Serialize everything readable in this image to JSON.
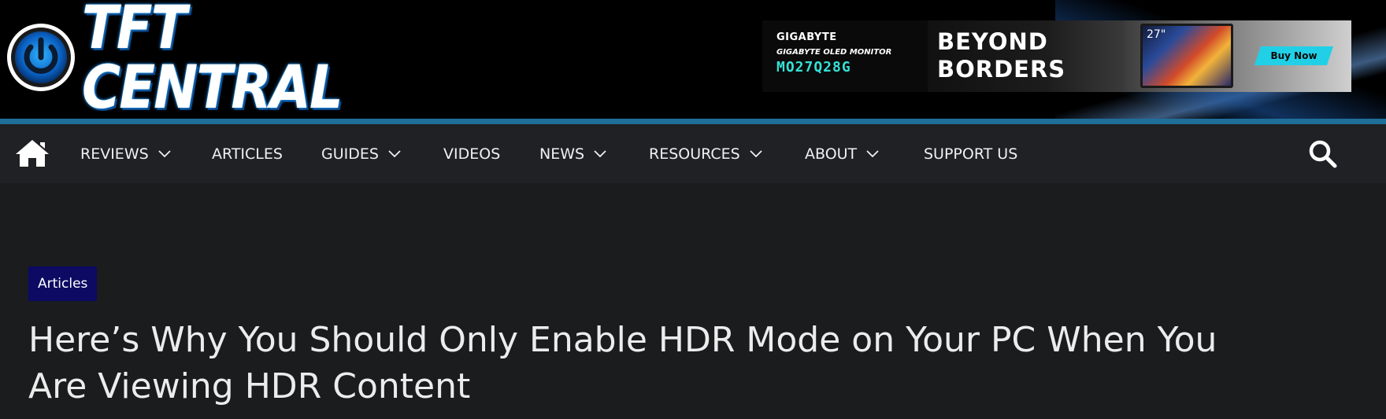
{
  "header": {
    "logo_text": "TFT CENTRAL",
    "colors": {
      "background": "#000000",
      "stripe": "#1f6f99"
    }
  },
  "ad": {
    "brand": "GIGABYTE",
    "subtitle": "GIGABYTE OLED MONITOR",
    "model": "MO27Q28G",
    "headline_line1": "BEYOND",
    "headline_line2": "BORDERS",
    "monitor_size": "27\"",
    "cta": "Buy Now",
    "colors": {
      "model": "#34e0d6",
      "cta": "#21d0e6"
    }
  },
  "nav": {
    "home_icon": "home-icon",
    "search_icon": "search-icon",
    "items": [
      {
        "label": "REVIEWS",
        "has_dropdown": true
      },
      {
        "label": "ARTICLES",
        "has_dropdown": false
      },
      {
        "label": "GUIDES",
        "has_dropdown": true
      },
      {
        "label": "VIDEOS",
        "has_dropdown": false
      },
      {
        "label": "NEWS",
        "has_dropdown": true
      },
      {
        "label": "RESOURCES",
        "has_dropdown": true
      },
      {
        "label": "ABOUT",
        "has_dropdown": true
      },
      {
        "label": "SUPPORT US",
        "has_dropdown": false
      }
    ],
    "colors": {
      "background": "#1f2124",
      "text": "#f0f0f0"
    }
  },
  "article": {
    "category": "Articles",
    "title_line1": "Here’s Why You Should Only Enable HDR Mode on Your PC When You",
    "title_line2": "Are Viewing HDR Content",
    "colors": {
      "badge": "#0c0a63",
      "background": "#1b1c1e"
    }
  }
}
